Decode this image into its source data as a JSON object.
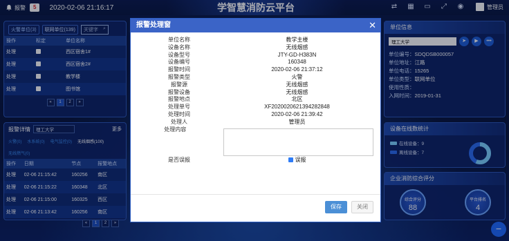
{
  "topbar": {
    "alarm_label": "报警",
    "alarm_count": "5",
    "datetime": "2020-02-06 21:16:17",
    "title": "学智慧消防云平台",
    "user": "管理员"
  },
  "left_panel": {
    "filter_fire": "火警单位(3)",
    "filter_network": "联网单位(139)",
    "search_placeholder": "关键字",
    "headers": [
      "操作",
      "标定",
      "单位名称"
    ],
    "rows": [
      {
        "op": "处理",
        "name": "西区宿舍1#"
      },
      {
        "op": "处理",
        "name": "西区宿舍2#"
      },
      {
        "op": "处理",
        "name": "教学楼"
      },
      {
        "op": "处理",
        "name": "图书馆"
      }
    ],
    "pager": [
      "«",
      "1",
      "2",
      "»"
    ]
  },
  "detail_panel": {
    "title": "报警详情",
    "unit": "理工大学",
    "more": "更多",
    "tabs": [
      "火警(0)",
      "水系统(0)",
      "电气监控(0)",
      "无线烟感(100)",
      "无线燃气(0)"
    ],
    "headers": [
      "操作",
      "日期",
      "节点",
      "报警地点"
    ],
    "rows": [
      {
        "op": "处理",
        "date": "02-06 21:15:42",
        "node": "160256",
        "loc": "南区"
      },
      {
        "op": "处理",
        "date": "02-06 21:15:22",
        "node": "160348",
        "loc": "北区"
      },
      {
        "op": "处理",
        "date": "02-06 21:15:00",
        "node": "160325",
        "loc": "西区"
      },
      {
        "op": "处理",
        "date": "02-06 21:13:42",
        "node": "160256",
        "loc": "南区"
      }
    ],
    "pager": [
      "«",
      "1",
      "2",
      "»"
    ]
  },
  "modal": {
    "title": "报警处理窗",
    "close": "✕",
    "fields": [
      {
        "k": "单位名称",
        "v": "教学主楼"
      },
      {
        "k": "设备名称",
        "v": "无线烟感"
      },
      {
        "k": "设备型号",
        "v": "JTY-GD-H383N"
      },
      {
        "k": "设备编号",
        "v": "160348"
      },
      {
        "k": "报警时间",
        "v": "2020-02-06 21:37:12"
      },
      {
        "k": "报警类型",
        "v": "火警"
      },
      {
        "k": "报警源",
        "v": "无线烟感"
      },
      {
        "k": "报警设备",
        "v": "无线烟感"
      },
      {
        "k": "报警地点",
        "v": "北区"
      },
      {
        "k": "处理单号",
        "v": "XF2020020621394282848"
      },
      {
        "k": "处理时间",
        "v": "2020-02-06 21:39:42"
      },
      {
        "k": "处理人",
        "v": "管理员"
      }
    ],
    "content_label": "处理内容",
    "false_alarm_label": "是否误报",
    "false_alarm_value": "误报",
    "save": "保存",
    "close_btn": "关闭"
  },
  "unit_info": {
    "title": "单位信息",
    "name": "理工大学",
    "rows": [
      {
        "k": "单位编号：",
        "v": "SDQDSB000057"
      },
      {
        "k": "单位地址：",
        "v": "江路"
      },
      {
        "k": "单位电话：",
        "v": "15265"
      },
      {
        "k": "单位类型：",
        "v": "联网单位"
      },
      {
        "k": "使用性质：",
        "v": ""
      },
      {
        "k": "入网时间：",
        "v": "2019-01-31"
      }
    ]
  },
  "online_stats": {
    "title": "设备在线数统计",
    "online": "在线设备：9",
    "offline": "离线设备：7",
    "online_value": 9,
    "offline_value": 7,
    "colors": {
      "online": "#7fd3ff",
      "offline": "#2b6cf0"
    }
  },
  "score_panel": {
    "title": "企业消防综合评分",
    "score_label": "综合评分",
    "score_value": "88",
    "rank_label": "平台排名",
    "rank_value": "4"
  }
}
